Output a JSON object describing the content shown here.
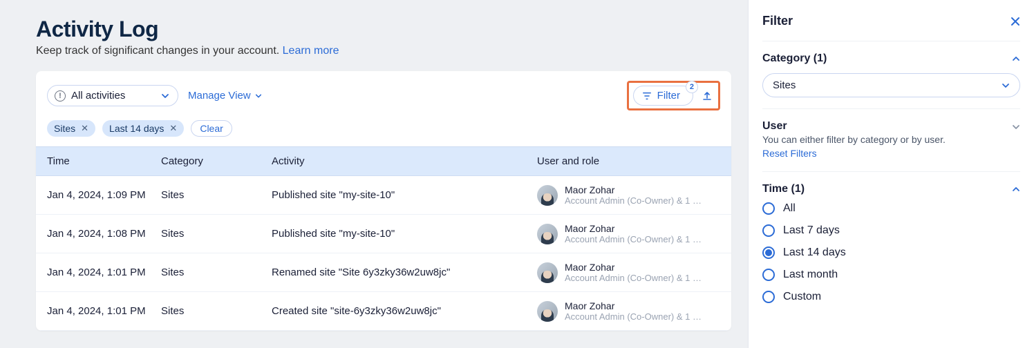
{
  "header": {
    "title": "Activity Log",
    "subtitle": "Keep track of significant changes in your account.",
    "learn_more": "Learn more"
  },
  "toolbar": {
    "activities_select": "All activities",
    "manage_view": "Manage View",
    "filter_label": "Filter",
    "filter_count": "2"
  },
  "chips": {
    "items": [
      "Sites",
      "Last 14 days"
    ],
    "clear": "Clear"
  },
  "table": {
    "columns": {
      "time": "Time",
      "category": "Category",
      "activity": "Activity",
      "user": "User and role"
    },
    "rows": [
      {
        "time": "Jan 4, 2024, 1:09 PM",
        "category": "Sites",
        "activity": "Published site \"my-site-10\"",
        "user": "Maor Zohar",
        "role": "Account Admin (Co-Owner) & 1 …"
      },
      {
        "time": "Jan 4, 2024, 1:08 PM",
        "category": "Sites",
        "activity": "Published site \"my-site-10\"",
        "user": "Maor Zohar",
        "role": "Account Admin (Co-Owner) & 1 …"
      },
      {
        "time": "Jan 4, 2024, 1:01 PM",
        "category": "Sites",
        "activity": "Renamed site \"Site 6y3zky36w2uw8jc\"",
        "user": "Maor Zohar",
        "role": "Account Admin (Co-Owner) & 1 …"
      },
      {
        "time": "Jan 4, 2024, 1:01 PM",
        "category": "Sites",
        "activity": "Created site \"site-6y3zky36w2uw8jc\"",
        "user": "Maor Zohar",
        "role": "Account Admin (Co-Owner) & 1 …"
      }
    ]
  },
  "filter_panel": {
    "title": "Filter",
    "category": {
      "label": "Category (1)",
      "value": "Sites"
    },
    "user": {
      "label": "User",
      "note": "You can either filter by category or by user.",
      "reset": "Reset Filters"
    },
    "time": {
      "label": "Time (1)",
      "options": [
        "All",
        "Last 7 days",
        "Last 14 days",
        "Last month",
        "Custom"
      ],
      "selected": "Last 14 days"
    }
  }
}
